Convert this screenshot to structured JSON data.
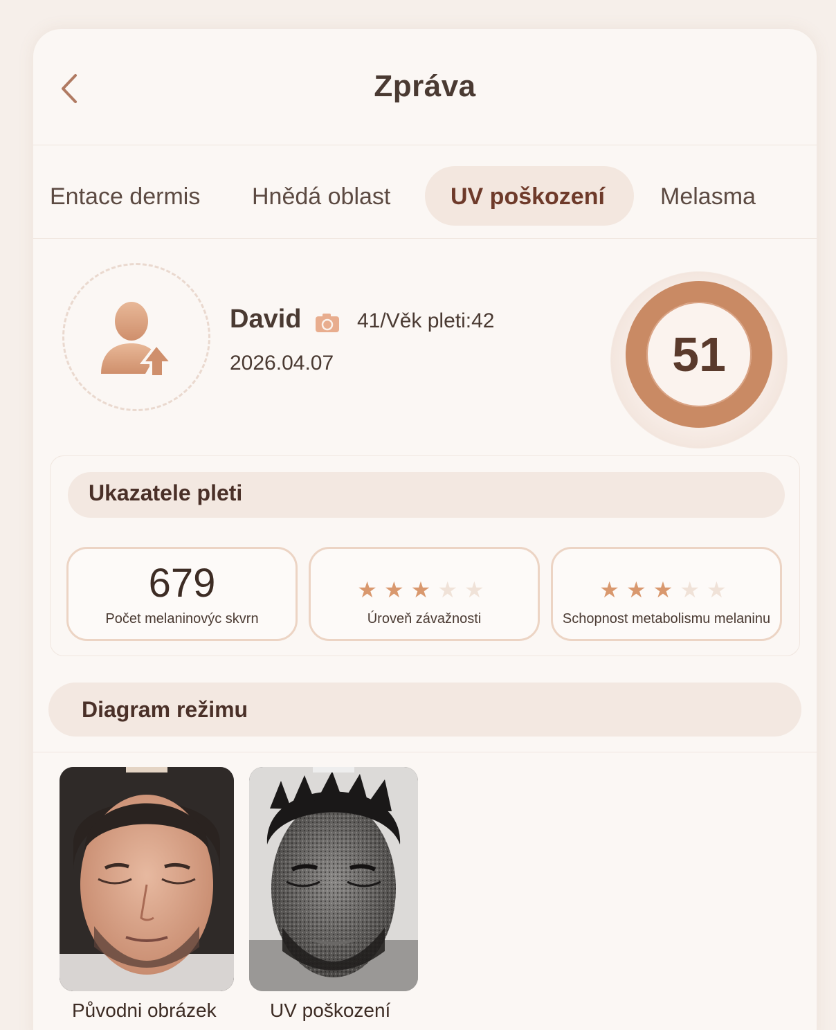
{
  "header": {
    "title": "Zpráva"
  },
  "tabs": [
    {
      "label": "Entace dermis",
      "active": false
    },
    {
      "label": "Hnědá oblast",
      "active": false
    },
    {
      "label": "UV poškození",
      "active": true
    },
    {
      "label": "Melasma",
      "active": false
    }
  ],
  "profile": {
    "name": "David",
    "age_text": "41/Věk pleti:42",
    "date": "2026.04.07",
    "score": "51"
  },
  "indicators": {
    "title": "Ukazatele pleti",
    "metrics": [
      {
        "value": "679",
        "label": "Počet melaninovýc skvrn"
      },
      {
        "stars": 3,
        "max": 5,
        "label": "Úroveň závažnosti"
      },
      {
        "stars": 3,
        "max": 5,
        "label": "Schopnost metabolismu melaninu"
      }
    ]
  },
  "diagram": {
    "title": "Diagram režimu",
    "images": [
      {
        "label": "Původni obrázek"
      },
      {
        "label": "UV poškození"
      }
    ]
  },
  "colors": {
    "accent": "#c98a64",
    "star": "#d9986e",
    "background": "#f6efea"
  }
}
